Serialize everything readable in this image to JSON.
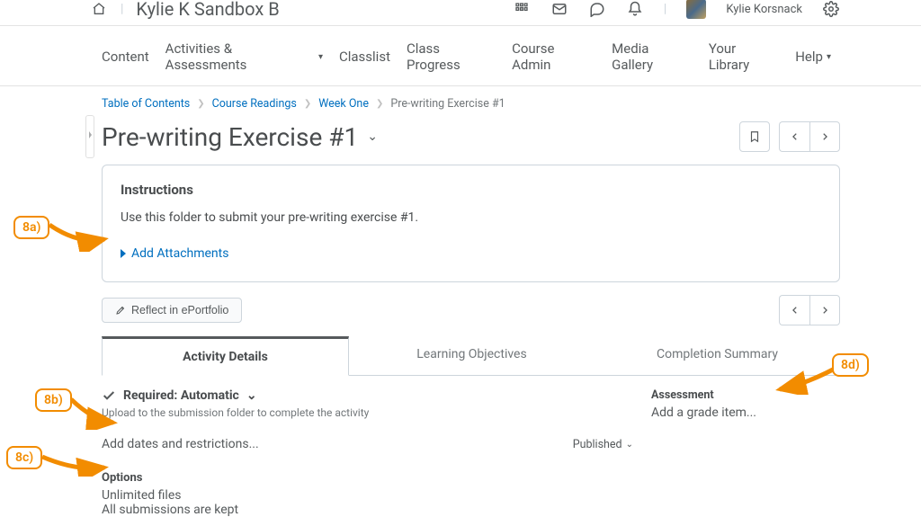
{
  "header": {
    "course_title": "Kylie K Sandbox B",
    "username": "Kylie Korsnack"
  },
  "coursenav": {
    "items": [
      "Content",
      "Activities & Assessments",
      "Classlist",
      "Class Progress",
      "Course Admin",
      "Media Gallery",
      "Your Library",
      "Help"
    ],
    "dropdown_indices": [
      1,
      7
    ]
  },
  "breadcrumb": {
    "links": [
      "Table of Contents",
      "Course Readings",
      "Week One"
    ],
    "current": "Pre-writing Exercise #1"
  },
  "page": {
    "title": "Pre-writing Exercise #1"
  },
  "instructions": {
    "heading": "Instructions",
    "body": "Use this folder to submit your pre-writing exercise #1.",
    "add_attachments": "Add Attachments"
  },
  "reflect_button": "Reflect in ePortfolio",
  "tabs": {
    "activity_details": "Activity Details",
    "learning_objectives": "Learning Objectives",
    "completion_summary": "Completion Summary"
  },
  "activity": {
    "required_label": "Required: Automatic",
    "required_hint": "Upload to the submission folder to complete the activity",
    "add_dates": "Add dates and restrictions...",
    "published": "Published",
    "options_heading": "Options",
    "options_lines": [
      "Unlimited files",
      "All submissions are kept"
    ]
  },
  "assessment": {
    "heading": "Assessment",
    "link": "Add a grade item..."
  },
  "annotations": {
    "a": "8a)",
    "b": "8b)",
    "c": "8c)",
    "d": "8d)"
  }
}
